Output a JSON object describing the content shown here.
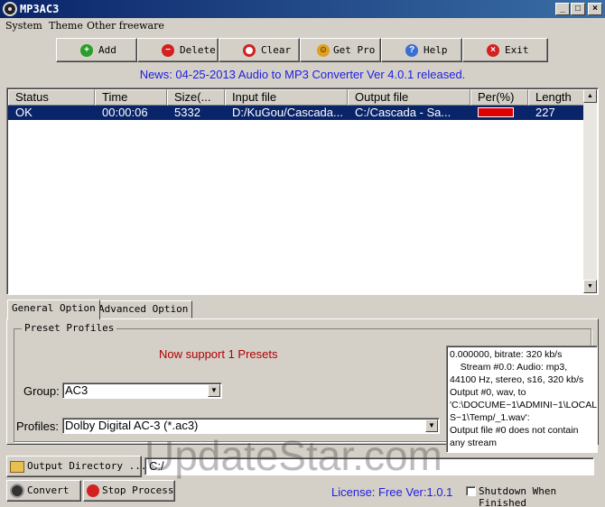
{
  "window": {
    "title": "MP3AC3",
    "minimize": "_",
    "maximize": "□",
    "close": "×"
  },
  "menu": [
    "System",
    "Theme",
    "Other freeware"
  ],
  "toolbar": [
    {
      "label": "Add",
      "icon": "add-icon",
      "color": "#2a9d2a",
      "glyph": "+"
    },
    {
      "label": "Delete",
      "icon": "delete-icon",
      "color": "#d42020",
      "glyph": "−"
    },
    {
      "label": "Clear",
      "icon": "clear-icon",
      "color": "#d42020",
      "glyph": ""
    },
    {
      "label": "Get Pro",
      "icon": "smiley-icon",
      "color": "#e0a020",
      "glyph": "☺"
    },
    {
      "label": "Help",
      "icon": "help-icon",
      "color": "#3a6fd0",
      "glyph": "?"
    },
    {
      "label": "Exit",
      "icon": "exit-icon",
      "color": "#d42020",
      "glyph": "×"
    }
  ],
  "news": "News: 04-25-2013 Audio to MP3 Converter Ver 4.0.1 released.",
  "list": {
    "columns": [
      "Status",
      "Time",
      "Size(...",
      "Input file",
      "Output file",
      "Per(%)",
      "Length"
    ],
    "rows": [
      {
        "status": "OK",
        "time": "00:00:06",
        "size": "5332",
        "input": "D:/KuGou/Cascada...",
        "output": "C:/Cascada - Sa...",
        "percent": 100,
        "length": "227"
      }
    ]
  },
  "tabs": {
    "general": "General Option",
    "advanced": "Advanced Option"
  },
  "presets": {
    "title": "Preset Profiles",
    "message": "Now support 1 Presets",
    "group_label": "Group:",
    "group_value": "AC3",
    "profiles_label": "Profiles:",
    "profiles_value": "Dolby Digital AC-3 (*.ac3)"
  },
  "log": [
    "0.000000, bitrate: 320 kb/s",
    "    Stream #0.0: Audio: mp3,",
    "44100 Hz, stereo, s16, 320 kb/s",
    "Output #0, wav, to",
    "'C:\\DOCUME~1\\ADMINI~1\\LOCAL",
    "S~1\\Temp/_1.wav':",
    "Output file #0 does not contain",
    "any stream"
  ],
  "bottom": {
    "output_dir_button": "Output Directory ...",
    "output_dir_value": "C:/",
    "convert_button": "Convert",
    "stop_button": "Stop Process",
    "license": "License: Free Ver:1.0.1",
    "shutdown_label": "Shutdown When Finished"
  },
  "watermark": "UpdateStar.com"
}
